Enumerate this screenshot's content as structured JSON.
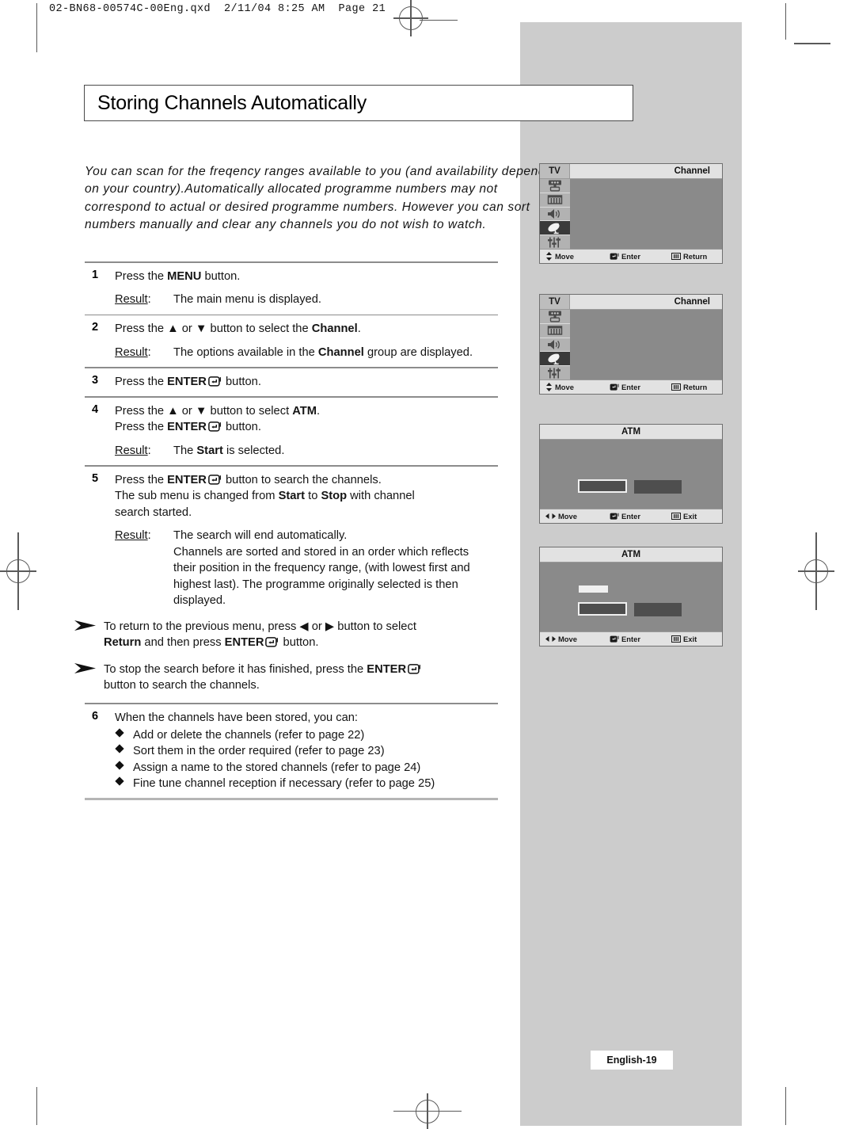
{
  "print_header": "02-BN68-00574C-00Eng.qxd  2/11/04 8:25 AM  Page 21",
  "title": "Storing Channels Automatically",
  "intro": "You can scan for the freqency ranges available to you (and availability depends on your country).Automatically allocated programme numbers may not correspond to actual or desired programme numbers. However you can sort numbers manually and clear any channels you do not wish to watch.",
  "steps": [
    {
      "num": "1",
      "lines": [
        "Press the |MENU| button."
      ],
      "result_label": "Result",
      "result_lines": [
        "The main menu is displayed."
      ]
    },
    {
      "num": "2",
      "lines": [
        "Press the ▲ or ▼ button to select the |Channel|."
      ],
      "result_label": "Result",
      "result_lines": [
        "The options available in the |Channel| group are displayed."
      ]
    },
    {
      "num": "3",
      "lines": [
        "Press the |ENTER|↵ button."
      ],
      "result_label": "",
      "result_lines": []
    },
    {
      "num": "4",
      "lines": [
        "Press the ▲ or ▼ button to select |ATM|.",
        "Press the |ENTER|↵ button."
      ],
      "result_label": "Result",
      "result_lines": [
        "The |Start| is selected."
      ]
    },
    {
      "num": "5",
      "lines": [
        "Press the |ENTER|↵ button to search the channels.",
        "The sub menu is changed from |Start| to |Stop| with channel",
        "search started."
      ],
      "result_label": "Result",
      "result_lines": [
        "The search will end automatically.",
        "Channels are sorted and stored in an order which reflects",
        "their position in the frequency range, (with lowest first and",
        "highest last). The programme originally selected is then",
        "displayed."
      ]
    }
  ],
  "notes": [
    {
      "lines": [
        "To return to the previous menu, press ◀ or ▶ button to select",
        "|Return| and then press |ENTER|↵ button."
      ]
    },
    {
      "lines": [
        "To stop the search before it has finished, press the |ENTER|↵",
        "button to search the channels."
      ]
    }
  ],
  "final_step": {
    "num": "6",
    "intro": "When the channels have been stored, you can:",
    "bullets": [
      "Add or delete the channels (refer to page 22)",
      "Sort them in the order required (refer to page 23)",
      "Assign a name to the stored channels (refer to page 24)",
      "Fine tune channel reception if necessary (refer to page 25)"
    ]
  },
  "osd_panels": [
    {
      "type": "menu",
      "tv_tag": "TV",
      "title": "Channel",
      "rail_icons": [
        "input-icon",
        "picture-icon",
        "sound-icon",
        "channel-dish-icon",
        "setup-sliders-icon"
      ],
      "active_index": 3,
      "footer": [
        {
          "icon": "updown-arrows-icon",
          "label": "Move"
        },
        {
          "icon": "enter-icon",
          "label": "Enter"
        },
        {
          "icon": "menu-bars-icon",
          "label": "Return"
        }
      ]
    },
    {
      "type": "menu",
      "tv_tag": "TV",
      "title": "Channel",
      "rail_icons": [
        "input-icon",
        "picture-icon",
        "sound-icon",
        "channel-dish-icon",
        "setup-sliders-icon"
      ],
      "active_index": 3,
      "footer": [
        {
          "icon": "updown-arrows-icon",
          "label": "Move"
        },
        {
          "icon": "enter-icon",
          "label": "Enter"
        },
        {
          "icon": "menu-bars-icon",
          "label": "Return"
        }
      ]
    },
    {
      "type": "atm",
      "title": "ATM",
      "has_progress": false,
      "footer": [
        {
          "icon": "leftright-arrows-icon",
          "label": "Move"
        },
        {
          "icon": "enter-icon",
          "label": "Enter"
        },
        {
          "icon": "menu-bars-icon",
          "label": "Exit"
        }
      ]
    },
    {
      "type": "atm",
      "title": "ATM",
      "has_progress": true,
      "footer": [
        {
          "icon": "leftright-arrows-icon",
          "label": "Move"
        },
        {
          "icon": "enter-icon",
          "label": "Enter"
        },
        {
          "icon": "menu-bars-icon",
          "label": "Exit"
        }
      ]
    }
  ],
  "page_tag": "English-19",
  "colors": {
    "grey_band": "#cccccc",
    "osd_body": "#8a8a8a",
    "osd_bar": "#e2e2e2",
    "osd_rail": "#b2b2b2",
    "osd_active": "#3a3a3a"
  }
}
